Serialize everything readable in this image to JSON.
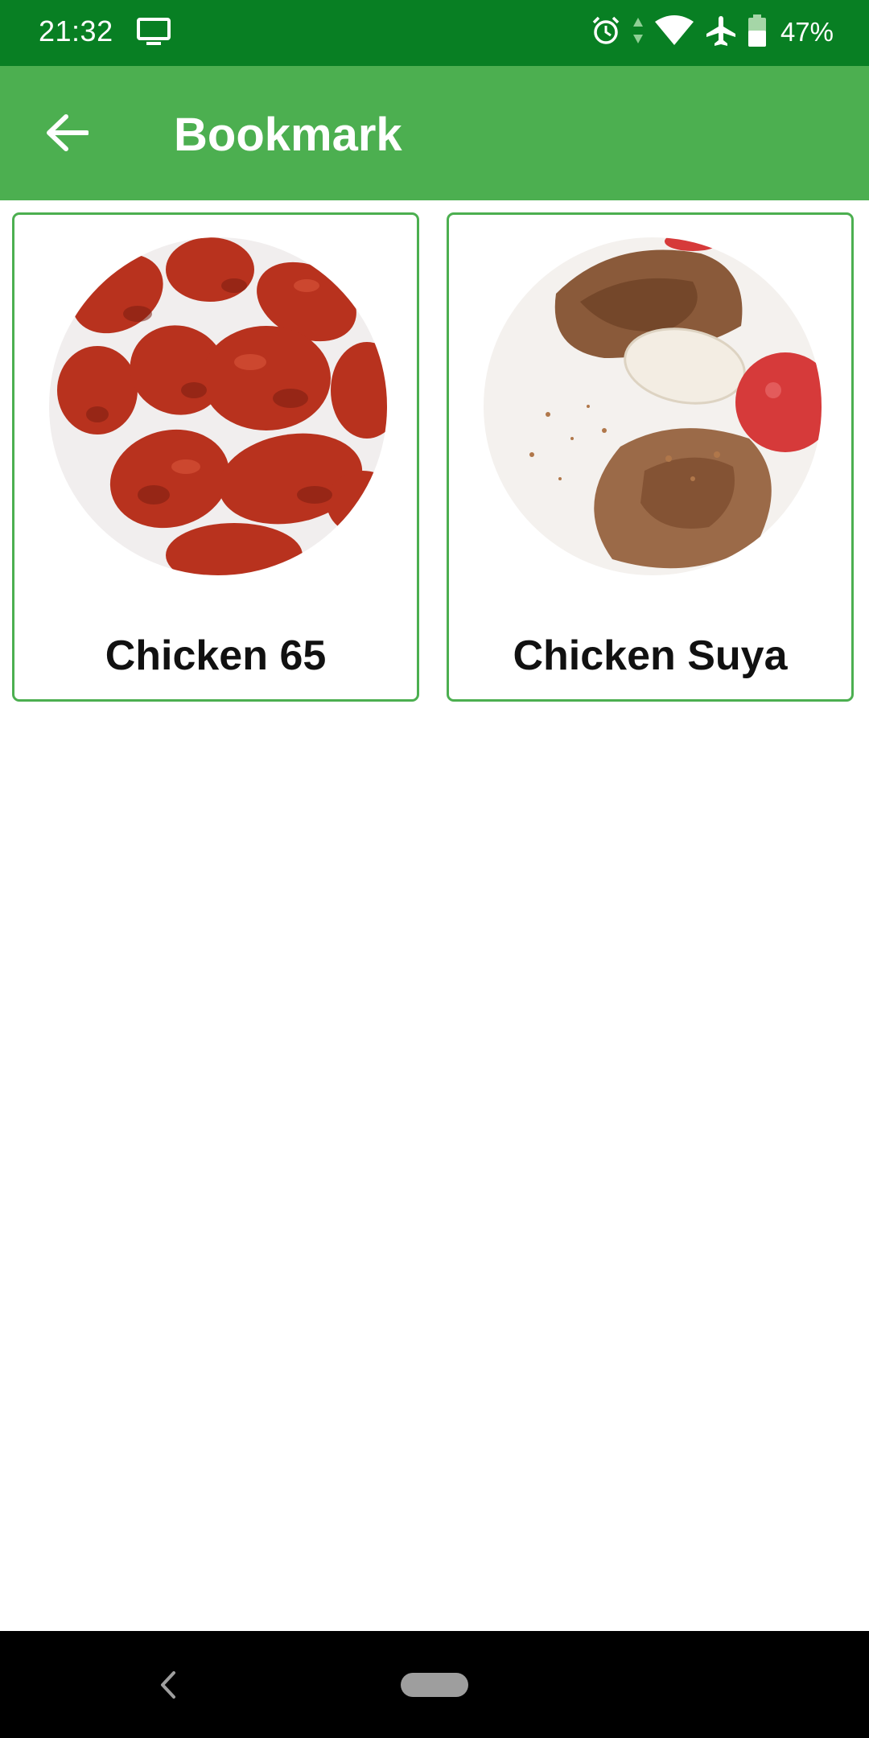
{
  "status_bar": {
    "time": "21:32",
    "battery_percent": "47%",
    "icons": [
      "cast-icon",
      "alarm-icon",
      "data-arrows-icon",
      "wifi-icon",
      "airplane-icon",
      "battery-icon"
    ]
  },
  "app_bar": {
    "title": "Bookmark",
    "back_icon": "arrow-back-icon"
  },
  "bookmarks": [
    {
      "title": "Chicken 65",
      "image": "fried-chicken-pieces-photo"
    },
    {
      "title": "Chicken Suya",
      "image": "grilled-chicken-onion-tomato-photo"
    }
  ],
  "nav_bar": {
    "icons": [
      "nav-back-icon",
      "home-pill"
    ]
  },
  "colors": {
    "status_bar": "#087f23",
    "app_bar": "#4caf50",
    "card_border": "#4caf50",
    "nav_bar": "#000000"
  }
}
